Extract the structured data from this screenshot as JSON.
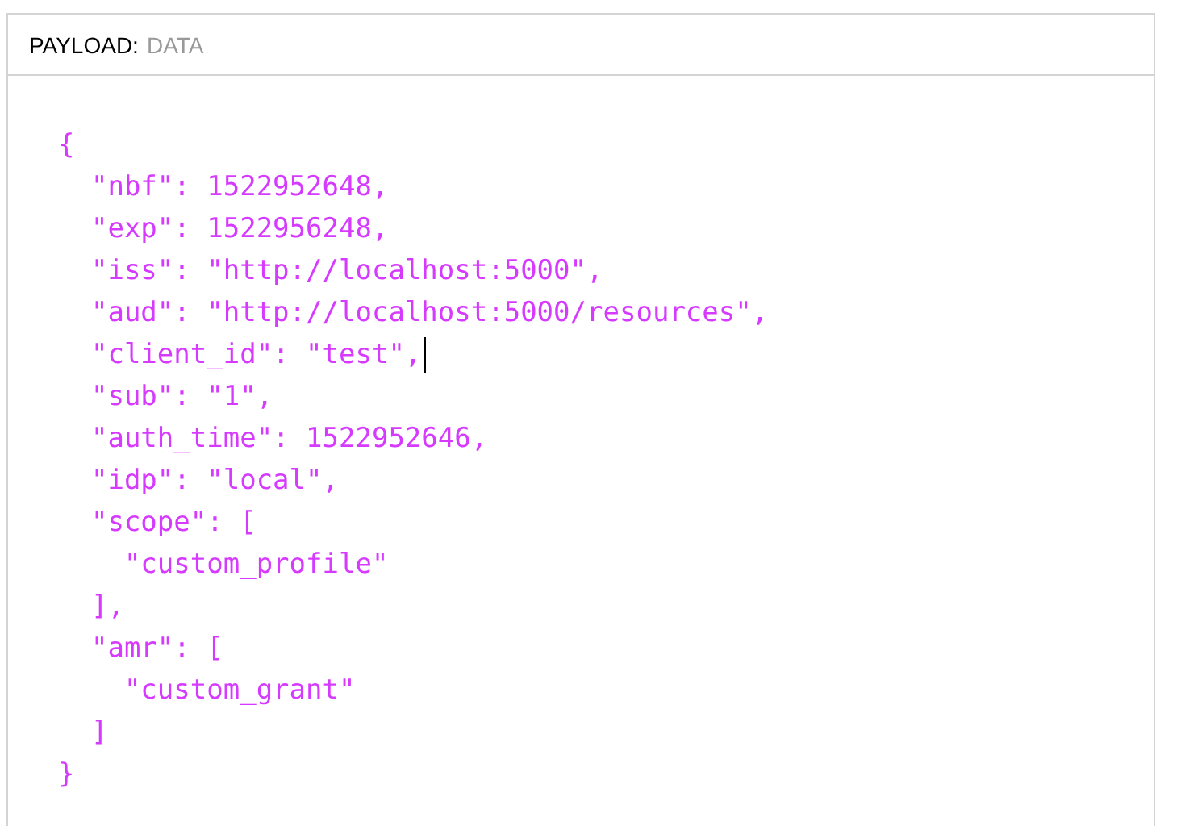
{
  "panel": {
    "title": "PAYLOAD:",
    "subtitle": "DATA"
  },
  "code_lines": [
    {
      "text": "{",
      "cursor": false
    },
    {
      "text": "  \"nbf\": 1522952648,",
      "cursor": false
    },
    {
      "text": "  \"exp\": 1522956248,",
      "cursor": false
    },
    {
      "text": "  \"iss\": \"http://localhost:5000\",",
      "cursor": false
    },
    {
      "text": "  \"aud\": \"http://localhost:5000/resources\",",
      "cursor": false
    },
    {
      "text": "  \"client_id\": \"test\",",
      "cursor": true
    },
    {
      "text": "  \"sub\": \"1\",",
      "cursor": false
    },
    {
      "text": "  \"auth_time\": 1522952646,",
      "cursor": false
    },
    {
      "text": "  \"idp\": \"local\",",
      "cursor": false
    },
    {
      "text": "  \"scope\": [",
      "cursor": false
    },
    {
      "text": "    \"custom_profile\"",
      "cursor": false
    },
    {
      "text": "  ],",
      "cursor": false
    },
    {
      "text": "  \"amr\": [",
      "cursor": false
    },
    {
      "text": "    \"custom_grant\"",
      "cursor": false
    },
    {
      "text": "  ]",
      "cursor": false
    },
    {
      "text": "}",
      "cursor": false
    }
  ]
}
